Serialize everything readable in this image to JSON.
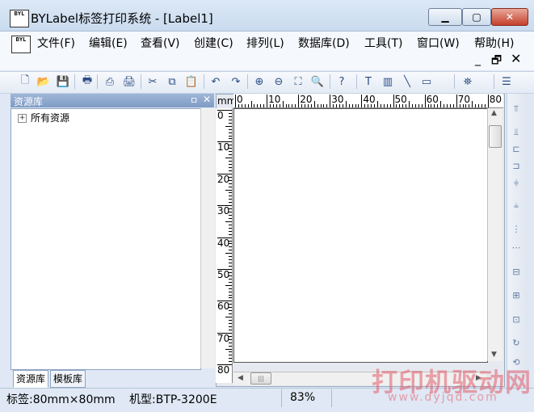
{
  "window": {
    "icon_text": "BYL",
    "title": "BYLabel标签打印系统 - [Label1]",
    "minimize": "▁",
    "maximize": "▢",
    "close": "✕"
  },
  "menu": {
    "items": [
      "文件(F)",
      "编辑(E)",
      "查看(V)",
      "创建(C)",
      "排列(L)",
      "数据库(D)",
      "工具(T)",
      "窗口(W)",
      "帮助(H)"
    ],
    "mdi_min": "_",
    "mdi_restore": "🗗",
    "mdi_close": "✕"
  },
  "toolbar": {
    "icons": [
      "new-icon",
      "open-icon",
      "save-icon",
      "print-icon",
      "print-preview-icon",
      "printer-setup-icon",
      "cut-icon",
      "copy-icon",
      "paste-icon",
      "undo-icon",
      "redo-icon",
      "zoom-in-icon",
      "zoom-out-icon",
      "zoom-fit-icon",
      "zoom-area-icon",
      "help-icon",
      "text-tool-icon",
      "barcode-tool-icon",
      "line-tool-icon",
      "rectangle-tool-icon",
      "find-icon",
      "grid-icon"
    ],
    "glyphs": [
      "🗋",
      "📂",
      "💾",
      "🖶",
      "⎙",
      "🖨",
      "✂",
      "⧉",
      "📋",
      "↶",
      "↷",
      "⊕",
      "⊖",
      "⛶",
      "🔍",
      "?",
      "T",
      "▥",
      "╲",
      "▭",
      "⛯",
      "☰"
    ]
  },
  "resource_panel": {
    "title": "资源库",
    "pin": "ㅁ",
    "close": "✕",
    "tree_root": "所有资源",
    "tree_expander": "+",
    "tabs": [
      "资源库",
      "模板库"
    ]
  },
  "ruler": {
    "unit": "mm",
    "h_labels": [
      "0",
      "10",
      "20",
      "30",
      "40",
      "50",
      "60",
      "70",
      "80"
    ],
    "v_labels": [
      "0",
      "10",
      "20",
      "30",
      "40",
      "50",
      "60",
      "70",
      "80"
    ]
  },
  "statusbar": {
    "label_size": "标签:80mm×80mm",
    "printer_model": "机型:BTP-3200E",
    "zoom": "83%"
  },
  "watermark": {
    "text": "打印机驱动网",
    "url": "www.dyjqd.com"
  },
  "colors": {
    "title_gradient_top": "#dce8f5",
    "panel_header": "#8aa5cc",
    "close_button": "#c4402c",
    "watermark": "#e35d6a"
  }
}
